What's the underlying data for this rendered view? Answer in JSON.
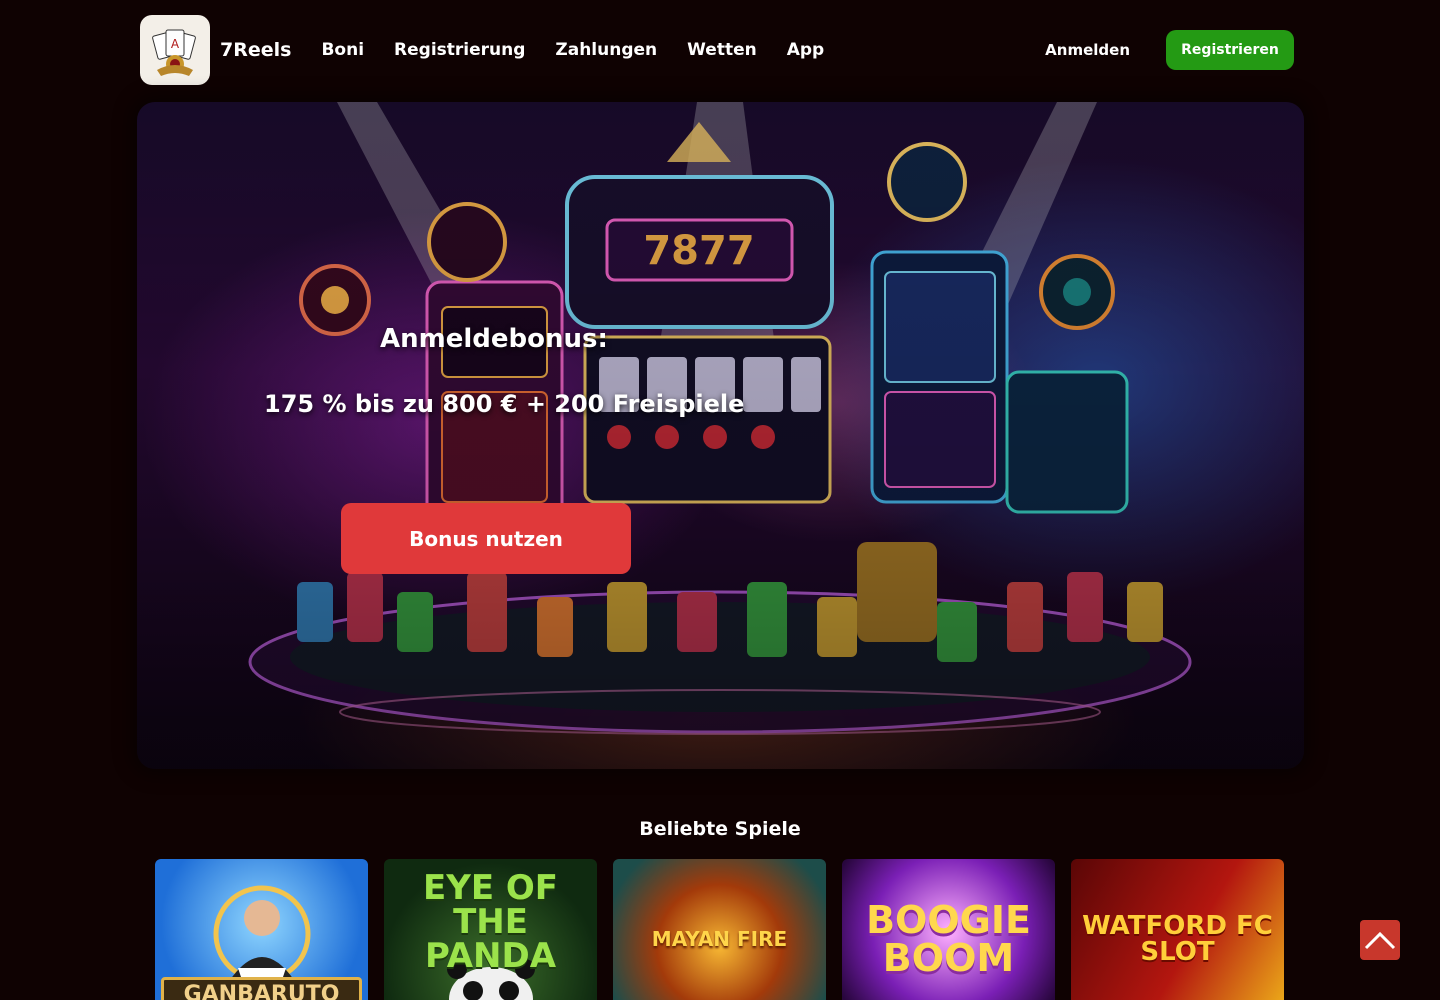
{
  "header": {
    "brand": "7Reels",
    "nav": [
      "Boni",
      "Registrierung",
      "Zahlungen",
      "Wetten",
      "App"
    ],
    "login_label": "Anmelden",
    "register_label": "Registrieren"
  },
  "hero": {
    "title": "Anmeldebonus:",
    "subtitle": "175 % bis zu 800 € + 200 Freispiele",
    "cta_label": "Bonus nutzen"
  },
  "games": {
    "section_title": "Beliebte Spiele",
    "items": [
      {
        "label": "GANBARUTO"
      },
      {
        "label": "EYE OF THE PANDA"
      },
      {
        "label": "MAYAN FIRE"
      },
      {
        "label": "BOOGIE BOOM"
      },
      {
        "label": "WATFORD FC SLOT"
      }
    ]
  },
  "colors": {
    "background": "#0f0202",
    "register_button": "#249a14",
    "cta_button": "#e0393a",
    "scroll_top": "#c8372c"
  },
  "icons": {
    "logo": "casino-logo-icon",
    "scroll_top": "chevron-up-icon"
  }
}
